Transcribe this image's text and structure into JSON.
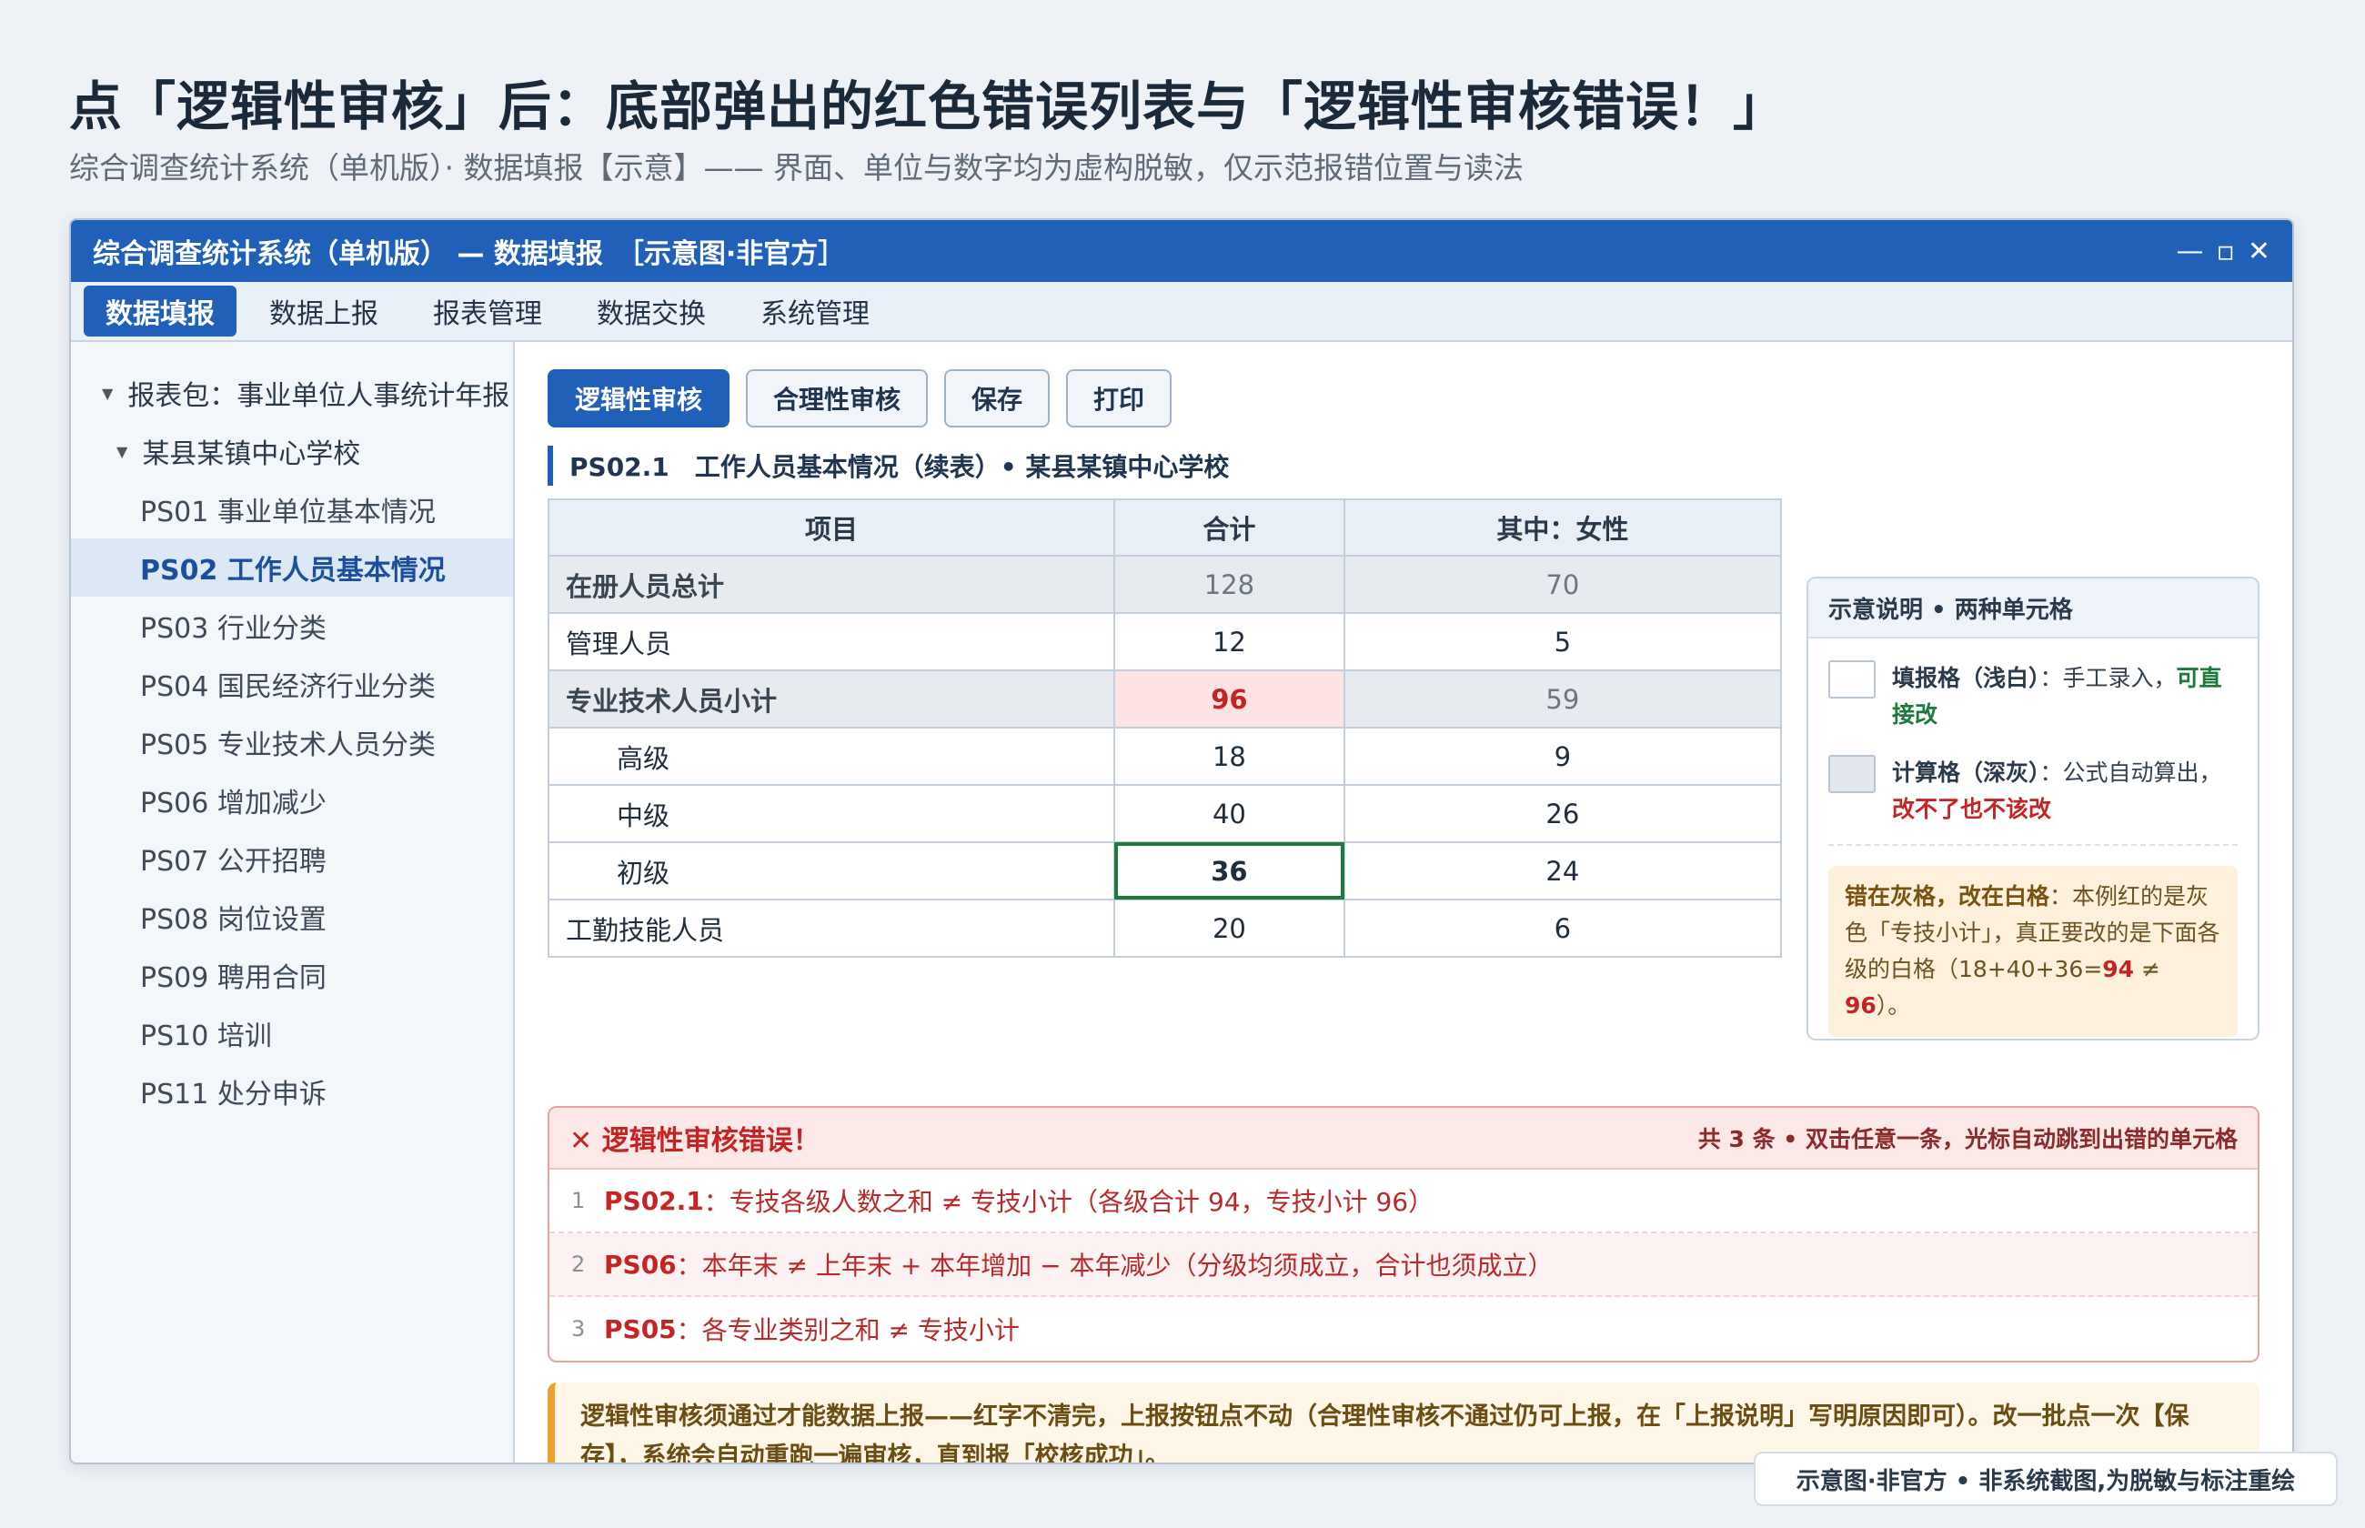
{
  "page": {
    "title": "点「逻辑性审核」后：底部弹出的红色错误列表与「逻辑性审核错误！」",
    "subtitle": "综合调查统计系统（单机版）· 数据填报【示意】—— 界面、单位与数字均为虚构脱敏，仅示范报错位置与读法"
  },
  "window": {
    "title": "综合调查统计系统（单机版） — 数据填报　［示意图·非官方］",
    "controls": {
      "minimize": "—",
      "maximize": "▫",
      "close": "✕"
    }
  },
  "menu": [
    {
      "label": "数据填报",
      "active": true
    },
    {
      "label": "数据上报"
    },
    {
      "label": "报表管理"
    },
    {
      "label": "数据交换"
    },
    {
      "label": "系统管理"
    }
  ],
  "sidebar": {
    "package": "报表包：事业单位人事统计年报",
    "unit": "某县某镇中心学校",
    "items": [
      "PS01 事业单位基本情况",
      "PS02 工作人员基本情况",
      "PS03 行业分类",
      "PS04 国民经济行业分类",
      "PS05 专业技术人员分类",
      "PS06 增加减少",
      "PS07 公开招聘",
      "PS08 岗位设置",
      "PS09 聘用合同",
      "PS10 培训",
      "PS11 处分申诉"
    ],
    "selected_index": 1
  },
  "toolbar": {
    "logic_check": "逻辑性审核",
    "reason_check": "合理性审核",
    "save": "保存",
    "print": "打印"
  },
  "table": {
    "caption": "PS02.1　工作人员基本情况（续表）• 某县某镇中心学校",
    "headers": [
      "项目",
      "合计",
      "其中：女性"
    ],
    "rows": [
      {
        "item": "在册人员总计",
        "total": "128",
        "female": "70"
      },
      {
        "item": "管理人员",
        "total": "12",
        "female": "5"
      },
      {
        "item": "专业技术人员小计",
        "total": "96",
        "female": "59"
      },
      {
        "item": "高级",
        "total": "18",
        "female": "9"
      },
      {
        "item": "中级",
        "total": "40",
        "female": "26"
      },
      {
        "item": "初级",
        "total": "36",
        "female": "24"
      },
      {
        "item": "工勤技能人员",
        "total": "20",
        "female": "6"
      }
    ]
  },
  "legend": {
    "title": "示意说明 • 两种单元格",
    "white_label": "填报格（浅白）",
    "white_desc": "：手工录入，",
    "white_emph": "可直接改",
    "gray_label": "计算格（深灰）",
    "gray_desc": "：公式自动算出，",
    "gray_emph": "改不了也不该改",
    "note_bold": "错在灰格，改在白格",
    "note_text": "：本例红的是灰色「专技小计」，真正要改的是下面各级的白格（18+40+36=",
    "note_a": "94",
    "note_neq": " ≠ ",
    "note_b": "96",
    "note_end": "）。"
  },
  "errors": {
    "title": "✕ 逻辑性审核错误！",
    "count_text": "共 3 条 • 双击任意一条，光标自动跳到出错的单元格",
    "items": [
      {
        "num": "1",
        "code": "PS02.1",
        "text": "：专技各级人数之和 ≠ 专技小计（各级合计 94，专技小计 96）"
      },
      {
        "num": "2",
        "code": "PS06",
        "text": "：本年末 ≠ 上年末 + 本年增加 − 本年减少（分级均须成立，合计也须成立）"
      },
      {
        "num": "3",
        "code": "PS05",
        "text": "：各专业类别之和 ≠ 专技小计"
      }
    ]
  },
  "notice": "逻辑性审核须通过才能数据上报——红字不清完，上报按钮点不动（合理性审核不通过仍可上报，在「上报说明」写明原因即可）。改一批点一次【保存】，系统会自动重跑一遍审核，直到报「校核成功」。",
  "footer": "示意图·非官方 • 非系统截图,为脱敏与标注重绘",
  "colors": {
    "brand": "#2060b8",
    "error": "#c42424",
    "ok": "#1d7a3a",
    "warn": "#f0a030"
  }
}
